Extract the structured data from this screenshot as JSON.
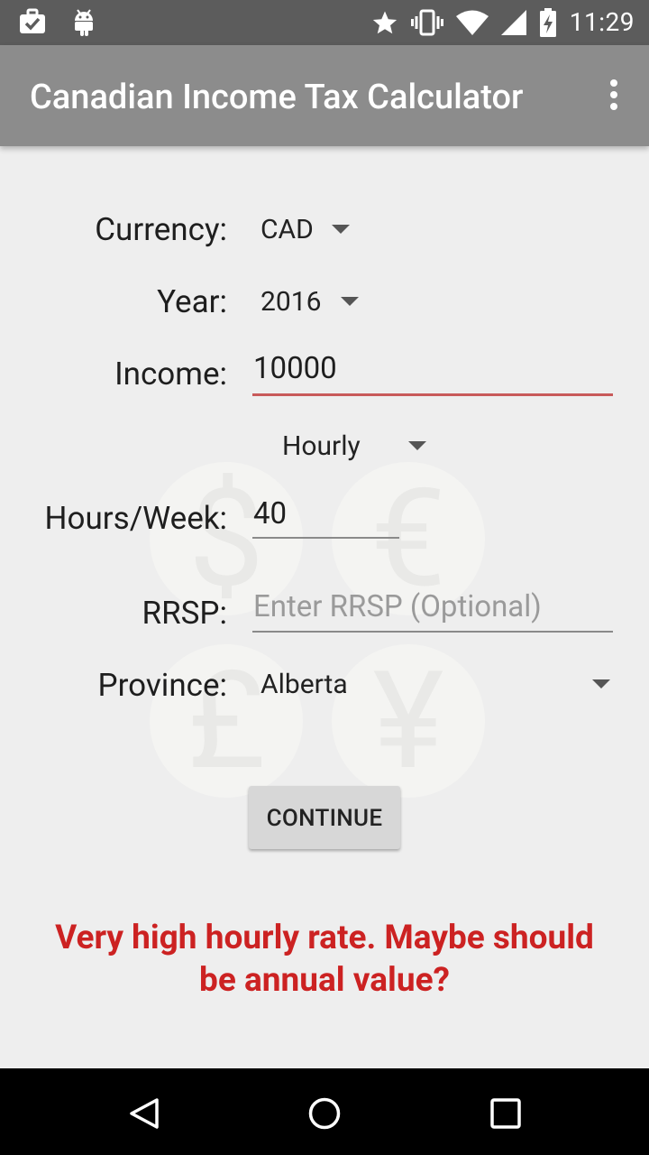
{
  "status_bar": {
    "time": "11:29",
    "left_icons": [
      "briefcase-check-icon",
      "android-icon"
    ],
    "right_icons": [
      "star-icon",
      "vibrate-icon",
      "wifi-icon",
      "signal-icon",
      "battery-charging-icon"
    ]
  },
  "app_bar": {
    "title": "Canadian Income Tax Calculator",
    "overflow_icon": "more-vert-icon"
  },
  "form": {
    "currency": {
      "label": "Currency:",
      "value": "CAD"
    },
    "year": {
      "label": "Year:",
      "value": "2016"
    },
    "income": {
      "label": "Income:",
      "value": "10000"
    },
    "income_period": {
      "value": "Hourly"
    },
    "hours_week": {
      "label": "Hours/Week:",
      "value": "40"
    },
    "rrsp": {
      "label": "RRSP:",
      "placeholder": "Enter RRSP (Optional)"
    },
    "province": {
      "label": "Province:",
      "value": "Alberta"
    }
  },
  "continue_button": {
    "label": "CONTINUE"
  },
  "warning": {
    "text": "Very high hourly rate. Maybe should be annual value?"
  },
  "watermark": {
    "symbols": [
      "$",
      "€",
      "£",
      "¥"
    ]
  },
  "nav_bar": {
    "icons": [
      "back-icon",
      "home-icon",
      "recents-icon"
    ]
  },
  "colors": {
    "app_bar": "#8c8c8c",
    "status_bar": "#5c5c5c",
    "accent_underline": "#c85a5a",
    "warning_text": "#cc2222",
    "background": "#eeeeee"
  }
}
